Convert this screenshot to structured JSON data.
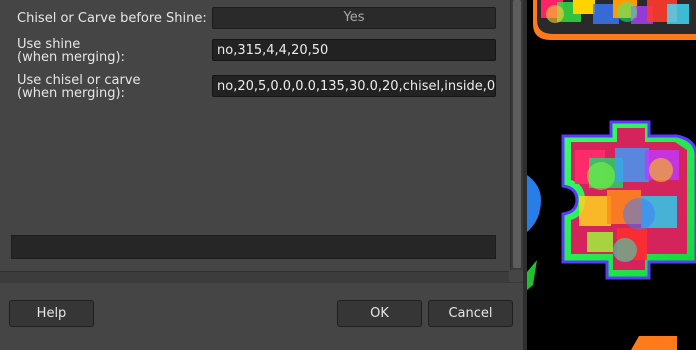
{
  "form": {
    "chisel_first": {
      "label": "Chisel or Carve before Shine:",
      "value": "Yes"
    },
    "shine": {
      "label": "Use shine\n(when merging):",
      "value": "no,315,4,4,20,50"
    },
    "chisel": {
      "label": "Use chisel or carve\n(when merging):",
      "value": "no,20,5,0.0,0.0,135,30.0,20,chisel,inside,0"
    }
  },
  "buttons": {
    "help": "Help",
    "ok": "OK",
    "cancel": "Cancel"
  },
  "colors": {
    "dialog_bg": "#454545",
    "field_bg": "#222222",
    "canvas_bg": "#000000"
  }
}
